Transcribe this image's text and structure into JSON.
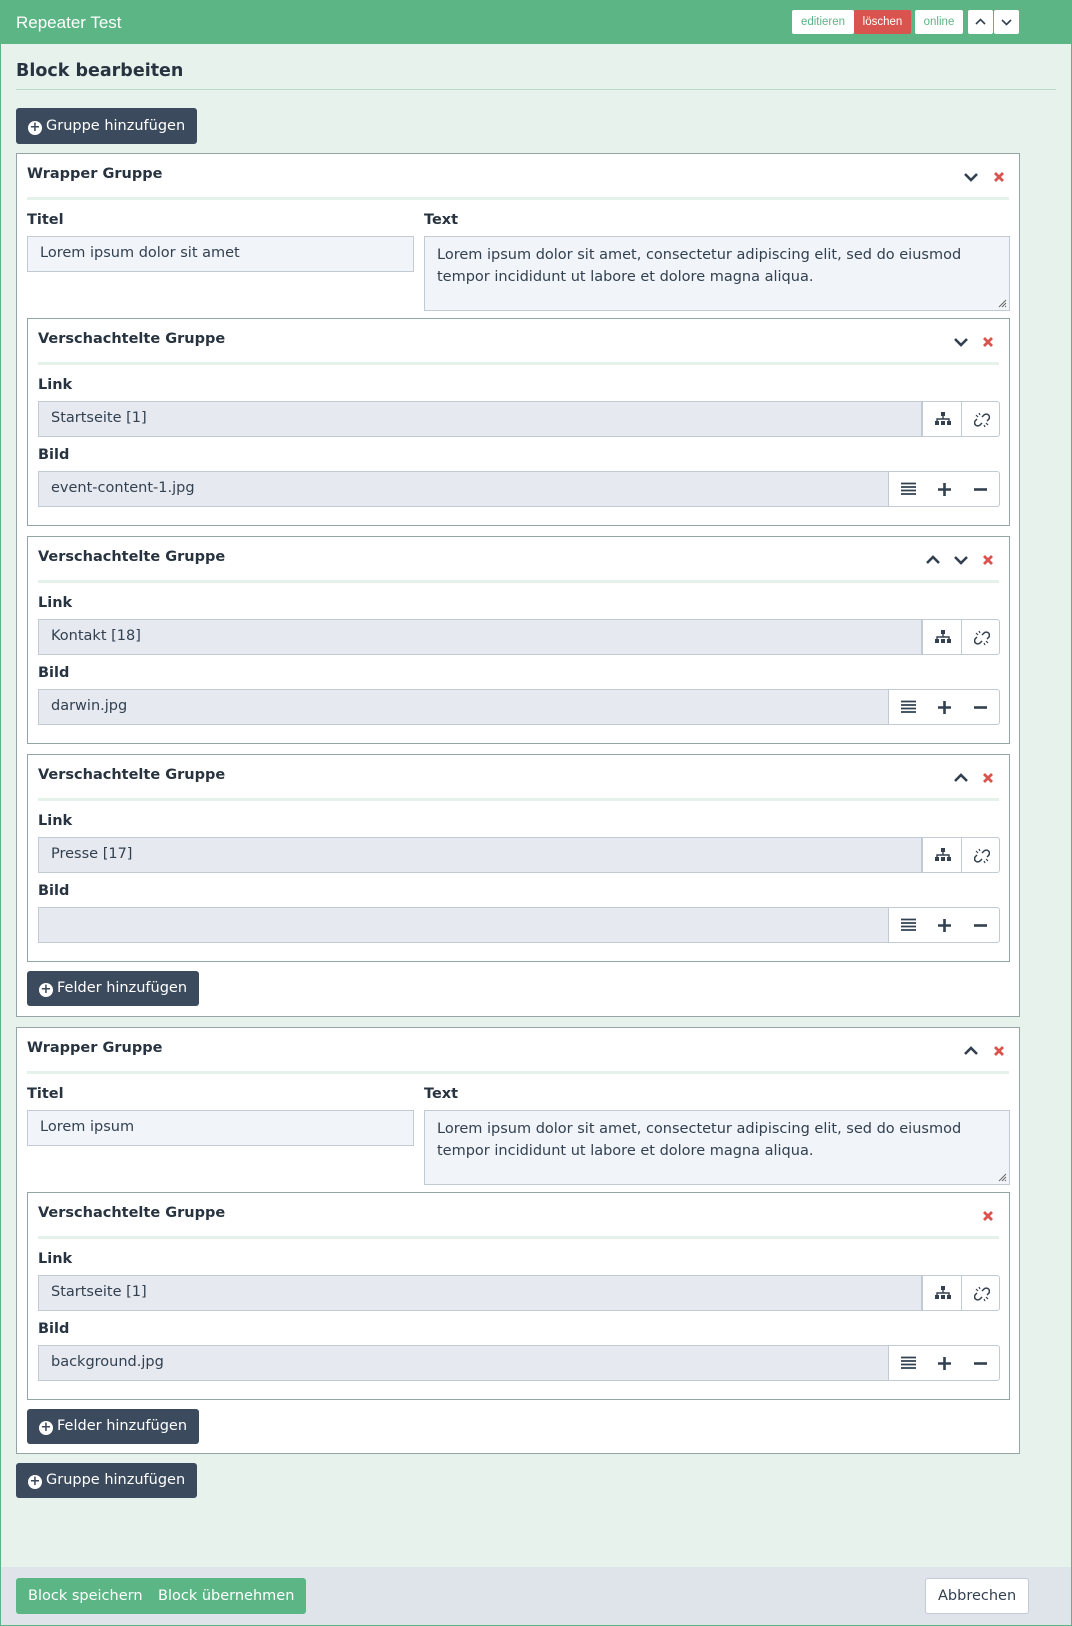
{
  "window": {
    "title": "Repeater Test"
  },
  "toolbar": {
    "edit_label": "editieren",
    "delete_label": "löschen",
    "status_label": "online"
  },
  "page": {
    "heading": "Block bearbeiten"
  },
  "actions": {
    "add_group_label": "Gruppe hinzufügen",
    "add_fields_label": "Felder hinzufügen"
  },
  "colors": {
    "accent": "#5bb585",
    "danger": "#d9534f",
    "dark_button": "#3b4a5c"
  },
  "labels": {
    "wrapper_group": "Wrapper Gruppe",
    "nested_group": "Verschachtelte Gruppe",
    "title": "Titel",
    "text": "Text",
    "link": "Link",
    "image": "Bild"
  },
  "wrappers": [
    {
      "title_value": "Lorem ipsum dolor sit amet",
      "text_value": "Lorem ipsum dolor sit amet, consectetur adipiscing elit, sed do eiusmod tempor incididunt ut labore et dolore magna aliqua.",
      "controls": [
        "chevron-down-icon",
        "close-icon"
      ],
      "nested": [
        {
          "link": "Startseite [1]",
          "image": "event-content-1.jpg",
          "controls": [
            "chevron-down-icon",
            "close-icon"
          ]
        },
        {
          "link": "Kontakt [18]",
          "image": "darwin.jpg",
          "controls": [
            "chevron-up-icon",
            "chevron-down-icon",
            "close-icon"
          ]
        },
        {
          "link": "Presse [17]",
          "image": "",
          "controls": [
            "chevron-up-icon",
            "close-icon"
          ]
        }
      ]
    },
    {
      "title_value": "Lorem ipsum",
      "text_value": "Lorem ipsum dolor sit amet, consectetur adipiscing elit, sed do eiusmod tempor incididunt ut labore et dolore magna aliqua.",
      "controls": [
        "chevron-up-icon",
        "close-icon"
      ],
      "nested": [
        {
          "link": "Startseite [1]",
          "image": "background.jpg",
          "controls": [
            "close-icon"
          ]
        }
      ]
    }
  ],
  "footer": {
    "save_label": "Block speichern",
    "apply_label": "Block übernehmen",
    "cancel_label": "Abbrechen"
  }
}
